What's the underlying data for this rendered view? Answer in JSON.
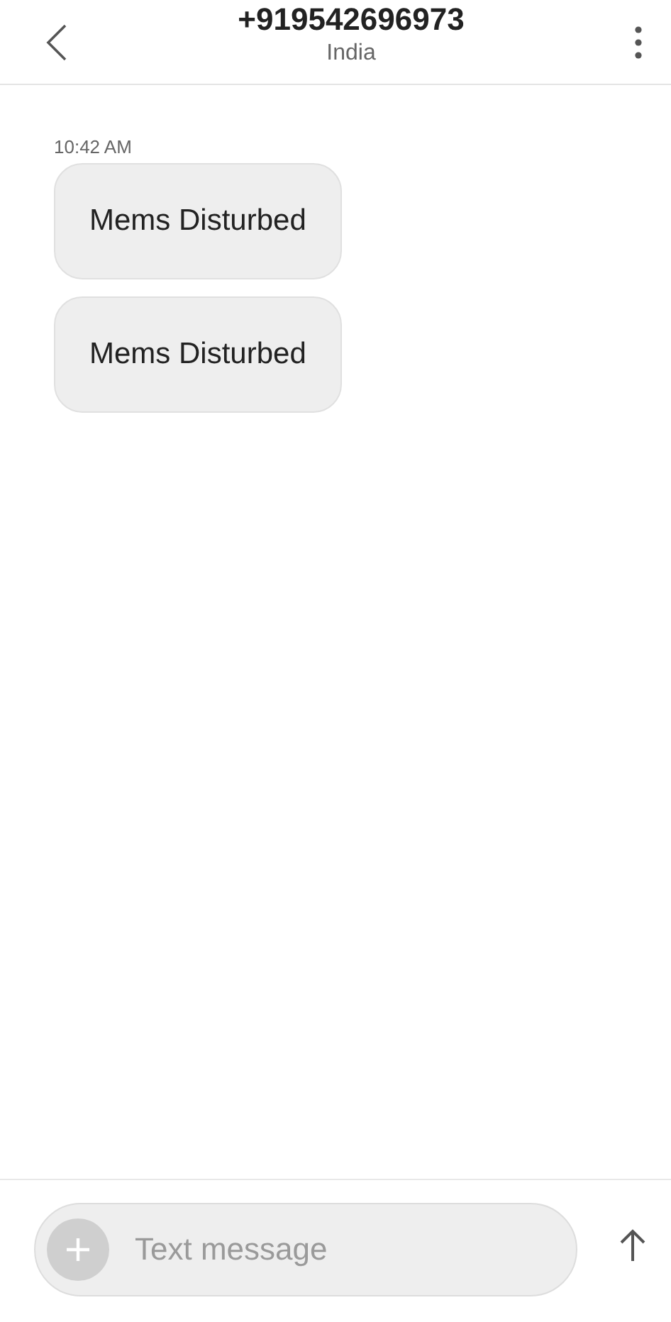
{
  "header": {
    "title": "+919542696973",
    "subtitle": "India"
  },
  "messages": [
    {
      "time": "10:42 AM",
      "text": "Mems Disturbed"
    },
    {
      "text": "Mems Disturbed"
    }
  ],
  "composer": {
    "placeholder": "Text message"
  }
}
